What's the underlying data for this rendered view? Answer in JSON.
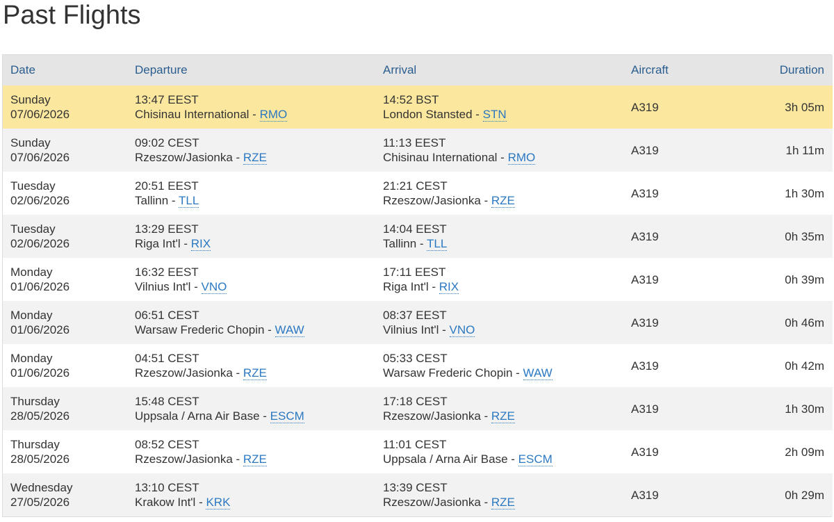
{
  "page": {
    "title": "Past Flights"
  },
  "table": {
    "headers": {
      "date": "Date",
      "departure": "Departure",
      "arrival": "Arrival",
      "aircraft": "Aircraft",
      "duration": "Duration"
    },
    "separator": " - ",
    "rows": [
      {
        "day": "Sunday",
        "date": "07/06/2026",
        "dep_time": "13:47 EEST",
        "dep_airport": "Chisinau International",
        "dep_code": "RMO",
        "arr_time": "14:52 BST",
        "arr_airport": "London Stansted",
        "arr_code": "STN",
        "aircraft": "A319",
        "duration": "3h 05m",
        "highlighted": true
      },
      {
        "day": "Sunday",
        "date": "07/06/2026",
        "dep_time": "09:02 CEST",
        "dep_airport": "Rzeszow/Jasionka",
        "dep_code": "RZE",
        "arr_time": "11:13 EEST",
        "arr_airport": "Chisinau International",
        "arr_code": "RMO",
        "aircraft": "A319",
        "duration": "1h 11m"
      },
      {
        "day": "Tuesday",
        "date": "02/06/2026",
        "dep_time": "20:51 EEST",
        "dep_airport": "Tallinn",
        "dep_code": "TLL",
        "arr_time": "21:21 CEST",
        "arr_airport": "Rzeszow/Jasionka",
        "arr_code": "RZE",
        "aircraft": "A319",
        "duration": "1h 30m"
      },
      {
        "day": "Tuesday",
        "date": "02/06/2026",
        "dep_time": "13:29 EEST",
        "dep_airport": "Riga Int'l",
        "dep_code": "RIX",
        "arr_time": "14:04 EEST",
        "arr_airport": "Tallinn",
        "arr_code": "TLL",
        "aircraft": "A319",
        "duration": "0h 35m"
      },
      {
        "day": "Monday",
        "date": "01/06/2026",
        "dep_time": "16:32 EEST",
        "dep_airport": "Vilnius Int'l",
        "dep_code": "VNO",
        "arr_time": "17:11 EEST",
        "arr_airport": "Riga Int'l",
        "arr_code": "RIX",
        "aircraft": "A319",
        "duration": "0h 39m"
      },
      {
        "day": "Monday",
        "date": "01/06/2026",
        "dep_time": "06:51 CEST",
        "dep_airport": "Warsaw Frederic Chopin",
        "dep_code": "WAW",
        "arr_time": "08:37 EEST",
        "arr_airport": "Vilnius Int'l",
        "arr_code": "VNO",
        "aircraft": "A319",
        "duration": "0h 46m"
      },
      {
        "day": "Monday",
        "date": "01/06/2026",
        "dep_time": "04:51 CEST",
        "dep_airport": "Rzeszow/Jasionka",
        "dep_code": "RZE",
        "arr_time": "05:33 CEST",
        "arr_airport": "Warsaw Frederic Chopin",
        "arr_code": "WAW",
        "aircraft": "A319",
        "duration": "0h 42m"
      },
      {
        "day": "Thursday",
        "date": "28/05/2026",
        "dep_time": "15:48 CEST",
        "dep_airport": "Uppsala / Arna Air Base",
        "dep_code": "ESCM",
        "arr_time": "17:18 CEST",
        "arr_airport": "Rzeszow/Jasionka",
        "arr_code": "RZE",
        "aircraft": "A319",
        "duration": "1h 30m"
      },
      {
        "day": "Thursday",
        "date": "28/05/2026",
        "dep_time": "08:52 CEST",
        "dep_airport": "Rzeszow/Jasionka",
        "dep_code": "RZE",
        "arr_time": "11:01 CEST",
        "arr_airport": "Uppsala / Arna Air Base",
        "arr_code": "ESCM",
        "aircraft": "A319",
        "duration": "2h 09m"
      },
      {
        "day": "Wednesday",
        "date": "27/05/2026",
        "dep_time": "13:10 CEST",
        "dep_airport": "Krakow Int'l",
        "dep_code": "KRK",
        "arr_time": "13:39 CEST",
        "arr_airport": "Rzeszow/Jasionka",
        "arr_code": "RZE",
        "aircraft": "A319",
        "duration": "0h 29m"
      }
    ]
  },
  "colors": {
    "header_bg": "#e5e5e5",
    "header_text": "#2a5d8f",
    "highlight_bg": "#fbe89e",
    "stripe_bg": "#f2f2f2",
    "link": "#2a78c2"
  }
}
